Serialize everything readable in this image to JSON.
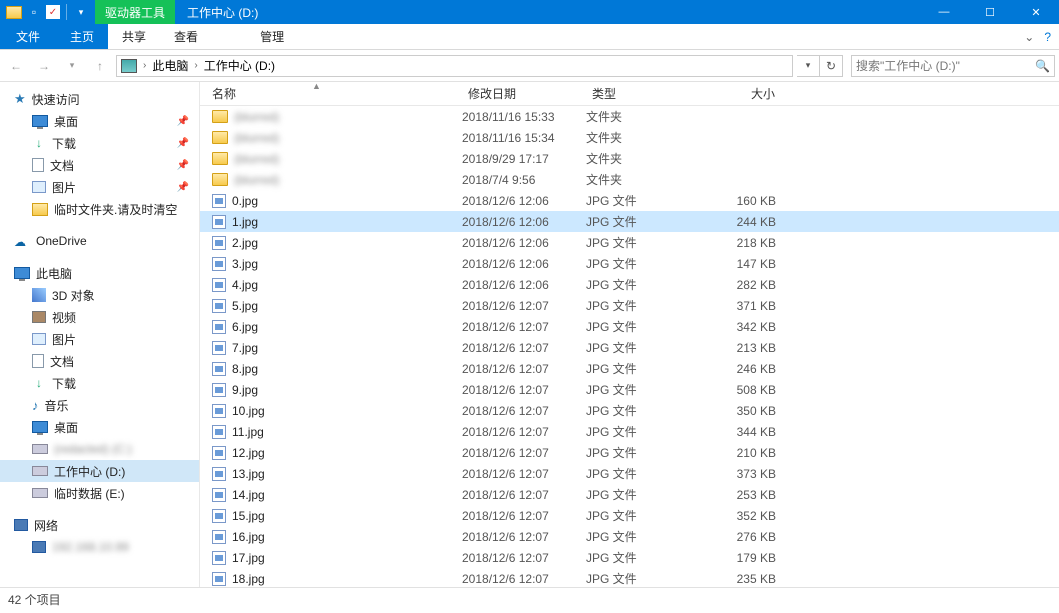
{
  "title_context_tab": "驱动器工具",
  "window_title": "工作中心 (D:)",
  "ribbon": {
    "file": "文件",
    "tabs": [
      "主页",
      "共享",
      "查看"
    ],
    "active": 0,
    "manage": "管理"
  },
  "breadcrumb": {
    "pc": "此电脑",
    "loc": "工作中心 (D:)"
  },
  "search_placeholder": "搜索\"工作中心 (D:)\"",
  "columns": {
    "name": "名称",
    "date": "修改日期",
    "type": "类型",
    "size": "大小"
  },
  "sidebar": {
    "quick": "快速访问",
    "quick_items": [
      {
        "icon": "monitor",
        "label": "桌面",
        "pin": true
      },
      {
        "icon": "down",
        "label": "下载",
        "pin": true
      },
      {
        "icon": "doc",
        "label": "文档",
        "pin": true
      },
      {
        "icon": "pic",
        "label": "图片",
        "pin": true
      },
      {
        "icon": "folder",
        "label": "临时文件夹.请及时清空",
        "pin": false
      }
    ],
    "onedrive": "OneDrive",
    "thispc": "此电脑",
    "thispc_items": [
      {
        "icon": "3d",
        "label": "3D 对象"
      },
      {
        "icon": "video",
        "label": "视频"
      },
      {
        "icon": "pic",
        "label": "图片"
      },
      {
        "icon": "doc",
        "label": "文档"
      },
      {
        "icon": "down",
        "label": "下载"
      },
      {
        "icon": "music",
        "label": "音乐"
      },
      {
        "icon": "monitor",
        "label": "桌面"
      },
      {
        "icon": "drive",
        "label": "(redacted) (C:)",
        "blur": true
      },
      {
        "icon": "drive",
        "label": "工作中心 (D:)",
        "selected": true
      },
      {
        "icon": "drive",
        "label": "临时数据 (E:)"
      }
    ],
    "network": "网络",
    "network_items": [
      {
        "icon": "net",
        "label": "192.168.10.99",
        "blur": true
      }
    ]
  },
  "files": [
    {
      "kind": "folder",
      "name": "(blurred)",
      "date": "2018/11/16 15:33",
      "type": "文件夹",
      "size": "",
      "blur": true
    },
    {
      "kind": "folder",
      "name": "(blurred)",
      "date": "2018/11/16 15:34",
      "type": "文件夹",
      "size": "",
      "blur": true
    },
    {
      "kind": "folder",
      "name": "(blurred)",
      "date": "2018/9/29 17:17",
      "type": "文件夹",
      "size": "",
      "blur": true
    },
    {
      "kind": "folder",
      "name": "(blurred)",
      "date": "2018/7/4 9:56",
      "type": "文件夹",
      "size": "",
      "blur": true
    },
    {
      "kind": "jpg",
      "name": "0.jpg",
      "date": "2018/12/6 12:06",
      "type": "JPG 文件",
      "size": "160 KB"
    },
    {
      "kind": "jpg",
      "name": "1.jpg",
      "date": "2018/12/6 12:06",
      "type": "JPG 文件",
      "size": "244 KB",
      "selected": true
    },
    {
      "kind": "jpg",
      "name": "2.jpg",
      "date": "2018/12/6 12:06",
      "type": "JPG 文件",
      "size": "218 KB"
    },
    {
      "kind": "jpg",
      "name": "3.jpg",
      "date": "2018/12/6 12:06",
      "type": "JPG 文件",
      "size": "147 KB"
    },
    {
      "kind": "jpg",
      "name": "4.jpg",
      "date": "2018/12/6 12:06",
      "type": "JPG 文件",
      "size": "282 KB"
    },
    {
      "kind": "jpg",
      "name": "5.jpg",
      "date": "2018/12/6 12:07",
      "type": "JPG 文件",
      "size": "371 KB"
    },
    {
      "kind": "jpg",
      "name": "6.jpg",
      "date": "2018/12/6 12:07",
      "type": "JPG 文件",
      "size": "342 KB"
    },
    {
      "kind": "jpg",
      "name": "7.jpg",
      "date": "2018/12/6 12:07",
      "type": "JPG 文件",
      "size": "213 KB"
    },
    {
      "kind": "jpg",
      "name": "8.jpg",
      "date": "2018/12/6 12:07",
      "type": "JPG 文件",
      "size": "246 KB"
    },
    {
      "kind": "jpg",
      "name": "9.jpg",
      "date": "2018/12/6 12:07",
      "type": "JPG 文件",
      "size": "508 KB"
    },
    {
      "kind": "jpg",
      "name": "10.jpg",
      "date": "2018/12/6 12:07",
      "type": "JPG 文件",
      "size": "350 KB"
    },
    {
      "kind": "jpg",
      "name": "11.jpg",
      "date": "2018/12/6 12:07",
      "type": "JPG 文件",
      "size": "344 KB"
    },
    {
      "kind": "jpg",
      "name": "12.jpg",
      "date": "2018/12/6 12:07",
      "type": "JPG 文件",
      "size": "210 KB"
    },
    {
      "kind": "jpg",
      "name": "13.jpg",
      "date": "2018/12/6 12:07",
      "type": "JPG 文件",
      "size": "373 KB"
    },
    {
      "kind": "jpg",
      "name": "14.jpg",
      "date": "2018/12/6 12:07",
      "type": "JPG 文件",
      "size": "253 KB"
    },
    {
      "kind": "jpg",
      "name": "15.jpg",
      "date": "2018/12/6 12:07",
      "type": "JPG 文件",
      "size": "352 KB"
    },
    {
      "kind": "jpg",
      "name": "16.jpg",
      "date": "2018/12/6 12:07",
      "type": "JPG 文件",
      "size": "276 KB"
    },
    {
      "kind": "jpg",
      "name": "17.jpg",
      "date": "2018/12/6 12:07",
      "type": "JPG 文件",
      "size": "179 KB"
    },
    {
      "kind": "jpg",
      "name": "18.jpg",
      "date": "2018/12/6 12:07",
      "type": "JPG 文件",
      "size": "235 KB"
    }
  ],
  "status": "42 个项目"
}
